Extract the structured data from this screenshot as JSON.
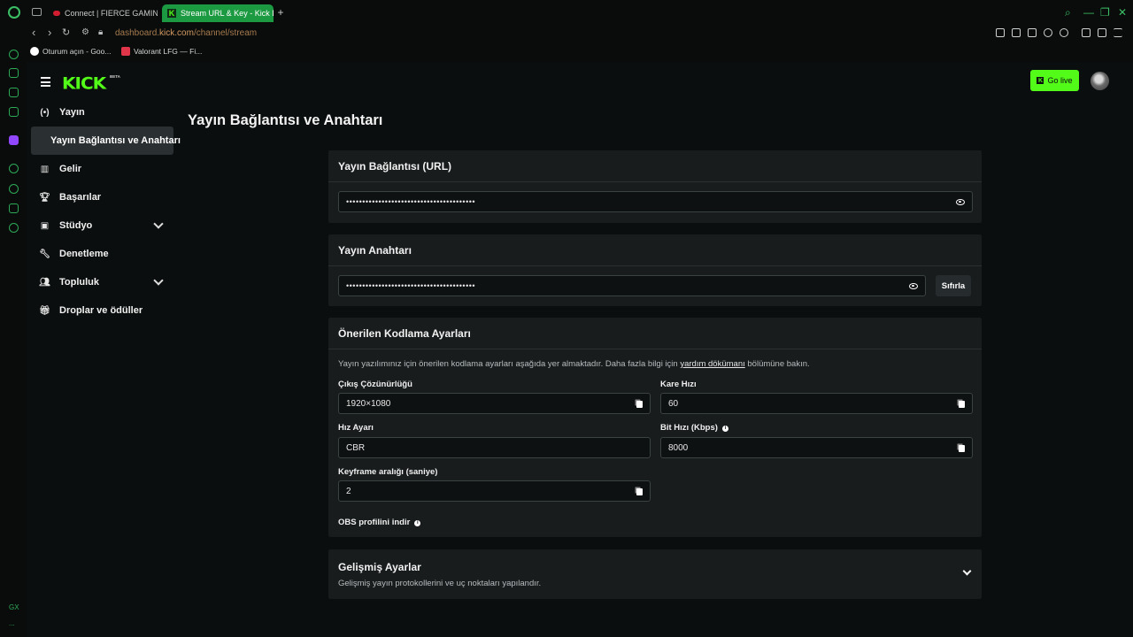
{
  "browser": {
    "tabs": [
      {
        "label": "Connect | FIERCE GAMING",
        "active": false
      },
      {
        "label": "Stream URL & Key - Kick D",
        "active": true
      }
    ],
    "url_prefix": "dashboard.",
    "url_domain": "kick.com",
    "url_path": "/channel/stream",
    "bookmarks": [
      {
        "label": "Oturum açın - Goo..."
      },
      {
        "label": "Valorant LFG — Fi..."
      }
    ],
    "rail_label": "GX",
    "rail_more": "..."
  },
  "header": {
    "logo": "KICK",
    "logo_badge": "BETA",
    "go_live_label": "Go live"
  },
  "sidebar": {
    "items": [
      {
        "label": "Yayın",
        "icon": "broadcast-icon"
      },
      {
        "label": "Yayın Bağlantısı ve Anahtarı",
        "icon": ""
      },
      {
        "label": "Gelir",
        "icon": "chart-icon"
      },
      {
        "label": "Başarılar",
        "icon": "trophy-icon"
      },
      {
        "label": "Stüdyo",
        "icon": "studio-icon"
      },
      {
        "label": "Denetleme",
        "icon": "wrench-icon"
      },
      {
        "label": "Topluluk",
        "icon": "people-icon"
      },
      {
        "label": "Droplar ve ödüller",
        "icon": "gift-icon"
      }
    ]
  },
  "main": {
    "title": "Yayın Bağlantısı ve Anahtarı",
    "url_card": {
      "title": "Yayın Bağlantısı (URL)",
      "value": "••••••••••••••••••••••••••••••••••••••••"
    },
    "key_card": {
      "title": "Yayın Anahtarı",
      "value": "••••••••••••••••••••••••••••••••••••••••",
      "reset_label": "Sıfırla"
    },
    "encoding_card": {
      "title": "Önerilen Kodlama Ayarları",
      "desc_before": "Yayın yazılımınız için önerilen kodlama ayarları aşağıda yer almaktadır. Daha fazla bilgi için ",
      "desc_link": "yardım dökümanı",
      "desc_after": " bölümüne bakın.",
      "fields": {
        "resolution_label": "Çıkış Çözünürlüğü",
        "resolution_value": "1920×1080",
        "framerate_label": "Kare Hızı",
        "framerate_value": "60",
        "rate_control_label": "Hız Ayarı",
        "rate_control_value": "CBR",
        "bitrate_label": "Bit Hızı (Kbps)",
        "bitrate_value": "8000",
        "keyframe_label": "Keyframe aralığı (saniye)",
        "keyframe_value": "2"
      },
      "obs_label": "OBS profilini indir"
    },
    "advanced_card": {
      "title": "Gelişmiş Ayarlar",
      "subtitle": "Gelişmiş yayın protokollerini ve uç noktaları yapılandır."
    }
  },
  "colors": {
    "brand": "#53fc18",
    "background": "#0b0e0f",
    "card": "#181c1d"
  }
}
